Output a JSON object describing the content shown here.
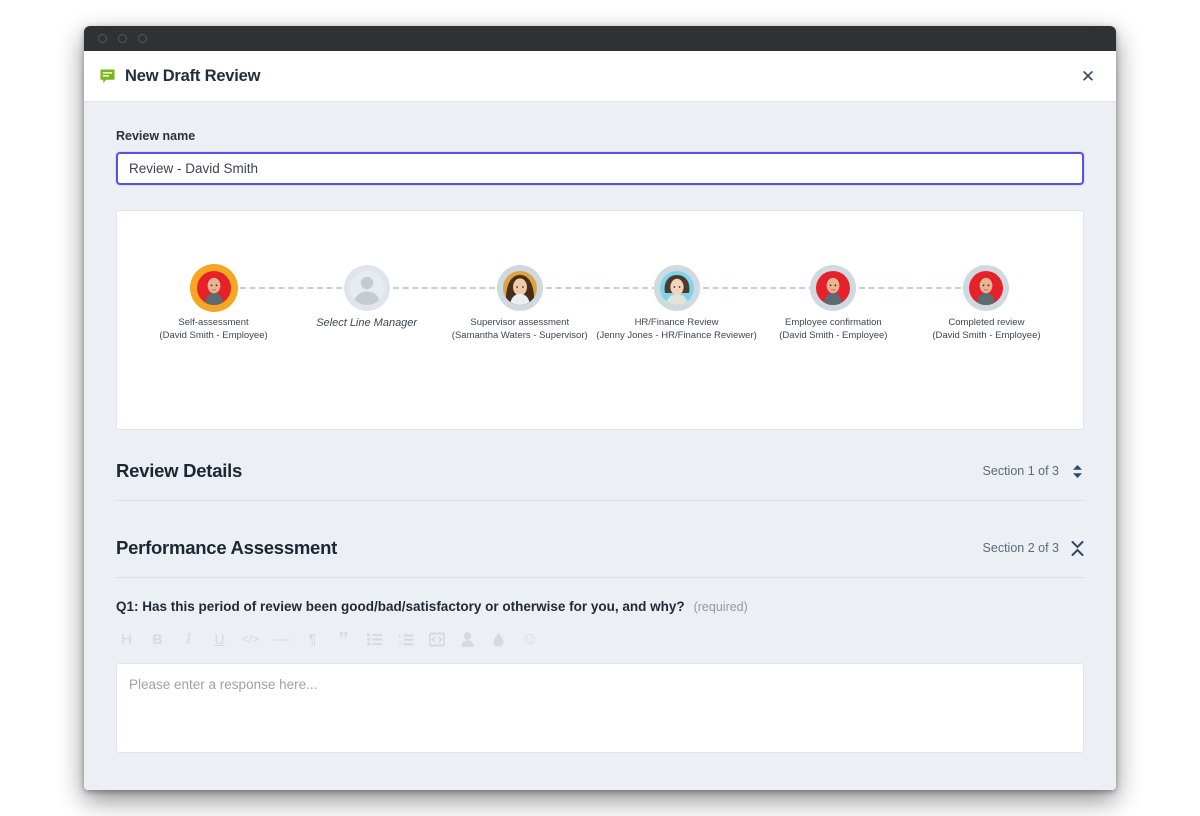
{
  "window": {
    "traffic_dots": [
      "close",
      "minimize",
      "maximize"
    ]
  },
  "header": {
    "icon": "comment-icon",
    "title": "New Draft Review",
    "close_label": "✕"
  },
  "form": {
    "review_name_label": "Review name",
    "review_name_value": "Review - David Smith",
    "review_name_placeholder": "Review name"
  },
  "workflow": {
    "steps": [
      {
        "title": "Self-assessment",
        "subtitle": "(David Smith - Employee)",
        "state": "active",
        "avatar": "david-smith-avatar",
        "bg": "#e8202a",
        "ring": "#f5a623"
      },
      {
        "title": "Select Line Manager",
        "subtitle": "",
        "state": "pending",
        "avatar": "placeholder-avatar",
        "bg": "#e3e8ec",
        "ring": "#dfe5ea"
      },
      {
        "title": "Supervisor assessment",
        "subtitle": "(Samantha Waters - Supervisor)",
        "state": "normal",
        "avatar": "samantha-waters-avatar",
        "bg": "#d9a441",
        "ring": "#cfd9e0"
      },
      {
        "title": "HR/Finance Review",
        "subtitle": "(Jenny Jones - HR/Finance Reviewer)",
        "state": "normal",
        "avatar": "jenny-jones-avatar",
        "bg": "#7fd3ea",
        "ring": "#cfd9e0"
      },
      {
        "title": "Employee confirmation",
        "subtitle": "(David Smith - Employee)",
        "state": "normal",
        "avatar": "david-smith-avatar",
        "bg": "#e8202a",
        "ring": "#cfd9e0"
      },
      {
        "title": "Completed review",
        "subtitle": "(David Smith - Employee)",
        "state": "normal",
        "avatar": "david-smith-avatar",
        "bg": "#e8202a",
        "ring": "#cfd9e0"
      }
    ]
  },
  "sections": [
    {
      "title": "Review Details",
      "meta": "Section 1 of 3",
      "toggle_icon": "chevron-up-down-icon",
      "state": "collapsed"
    },
    {
      "title": "Performance Assessment",
      "meta": "Section 2 of 3",
      "toggle_icon": "chevron-collapse-icon",
      "state": "expanded"
    }
  ],
  "question": {
    "text": "Q1: Has this period of review been good/bad/satisfactory or otherwise for you, and why?",
    "required_label": "(required)"
  },
  "editor": {
    "tools": [
      {
        "name": "heading-icon",
        "glyph": "H"
      },
      {
        "name": "bold-icon",
        "glyph": "B"
      },
      {
        "name": "italic-icon",
        "glyph": "I"
      },
      {
        "name": "underline-icon",
        "glyph": "U"
      },
      {
        "name": "inline-code-icon",
        "glyph": "</>"
      },
      {
        "name": "horizontal-rule-icon",
        "glyph": "—"
      },
      {
        "name": "paragraph-icon",
        "glyph": "¶"
      },
      {
        "name": "blockquote-icon",
        "glyph": "”"
      },
      {
        "name": "bullet-list-icon",
        "glyph": "list"
      },
      {
        "name": "numbered-list-icon",
        "glyph": "list-ol"
      },
      {
        "name": "code-block-icon",
        "glyph": "embed"
      },
      {
        "name": "mention-icon",
        "glyph": "person"
      },
      {
        "name": "color-icon",
        "glyph": "droplet"
      },
      {
        "name": "emoji-icon",
        "glyph": "☺"
      }
    ],
    "response_placeholder": "Please enter a response here..."
  },
  "colors": {
    "accent_focus": "#5b4fe0",
    "brand_green": "#7cb518",
    "page_bg": "#eceff3",
    "card_bg": "#ffffff",
    "muted_text": "#5a6b7c"
  }
}
